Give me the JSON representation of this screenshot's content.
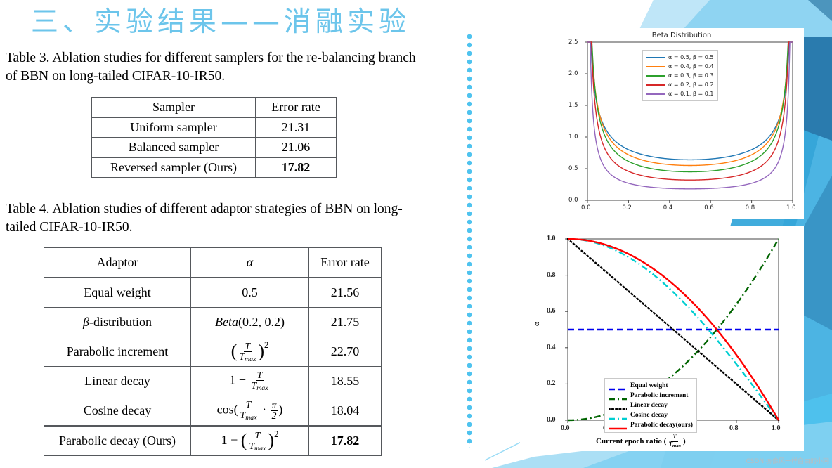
{
  "slide": {
    "title": "三、实验结果——消融实验",
    "title_color": "#6CC5EB",
    "background_accents": [
      "#8FD4F2",
      "#4FC3EF",
      "#2E86B8",
      "#2A7BAE",
      "#1F6B9A"
    ],
    "watermark": "CSDN @像风一样自由的小网"
  },
  "table3": {
    "caption": "Table 3. Ablation studies for different samplers for the re-balancing branch of BBN on long-tailed CIFAR-10-IR50.",
    "headers": [
      "Sampler",
      "Error rate"
    ],
    "rows": [
      {
        "sampler": "Uniform sampler",
        "error_rate": "21.31",
        "bold": false
      },
      {
        "sampler": "Balanced sampler",
        "error_rate": "21.06",
        "bold": false
      },
      {
        "sampler": "Reversed sampler (Ours)",
        "error_rate": "17.82",
        "bold": true
      }
    ]
  },
  "table4": {
    "caption": "Table 4. Ablation studies of different adaptor strategies of BBN on long-tailed CIFAR-10-IR50.",
    "headers": [
      "Adaptor",
      "α",
      "Error rate"
    ],
    "rows": [
      {
        "adaptor": "Equal weight",
        "alpha_text": "0.5",
        "error_rate": "21.56"
      },
      {
        "adaptor": "β-distribution",
        "alpha_text": "Beta(0.2, 0.2)",
        "error_rate": "21.75"
      },
      {
        "adaptor": "Parabolic increment",
        "alpha_text": "(T / Tmax)^2",
        "error_rate": "22.70"
      },
      {
        "adaptor": "Linear decay",
        "alpha_text": "1 − T / Tmax",
        "error_rate": "18.55"
      },
      {
        "adaptor": "Cosine decay",
        "alpha_text": "cos(T / Tmax · π/2)",
        "error_rate": "18.04"
      },
      {
        "adaptor": "Parabolic decay (Ours)",
        "alpha_text": "1 − (T / Tmax)^2",
        "error_rate": "17.82"
      }
    ]
  },
  "chart_data": [
    {
      "id": "beta-distribution",
      "type": "line",
      "title": "Beta Distribution",
      "xlabel": "",
      "ylabel": "",
      "xlim": [
        0.0,
        1.0
      ],
      "ylim": [
        0.0,
        2.5
      ],
      "xticks": [
        "0.0",
        "0.2",
        "0.4",
        "0.6",
        "0.8",
        "1.0"
      ],
      "yticks": [
        "0.0",
        "0.5",
        "1.0",
        "1.5",
        "2.0",
        "2.5"
      ],
      "grid": false,
      "legend_position": "upper center",
      "series": [
        {
          "name": "α = 0.5,  β = 0.5",
          "color": "#1f77b4",
          "style": "solid",
          "min_value": 0.64,
          "a": 0.5
        },
        {
          "name": "α = 0.4,  β = 0.4",
          "color": "#ff7f0e",
          "style": "solid",
          "min_value": 0.55,
          "a": 0.4
        },
        {
          "name": "α = 0.3,  β = 0.3",
          "color": "#2ca02c",
          "style": "solid",
          "min_value": 0.45,
          "a": 0.3
        },
        {
          "name": "α = 0.2,  β = 0.2",
          "color": "#d62728",
          "style": "solid",
          "min_value": 0.32,
          "a": 0.2
        },
        {
          "name": "α = 0.1,  β = 0.1",
          "color": "#9467bd",
          "style": "solid",
          "min_value": 0.18,
          "a": 0.1
        }
      ]
    },
    {
      "id": "adaptor-strategies",
      "type": "line",
      "title": "",
      "xlabel": "Current epoch ratio (T/Tmax)",
      "ylabel": "α",
      "xlim": [
        0.0,
        1.0
      ],
      "ylim": [
        0.0,
        1.0
      ],
      "xticks": [
        "0.0",
        "0.2",
        "0.4",
        "0.6",
        "0.8",
        "1.0"
      ],
      "yticks": [
        "0.0",
        "0.2",
        "0.4",
        "0.6",
        "0.8",
        "1.0"
      ],
      "grid": false,
      "legend_position": "lower left",
      "series": [
        {
          "name": "Equal weight",
          "color": "#0000ee",
          "style": "dashed",
          "formula": "0.5"
        },
        {
          "name": "Parabolic increment",
          "color": "#006400",
          "style": "dashdot",
          "formula": "t^2"
        },
        {
          "name": "Linear decay",
          "color": "#000000",
          "style": "dotted",
          "formula": "1-t"
        },
        {
          "name": "Cosine decay",
          "color": "#00CED1",
          "style": "dashdot",
          "formula": "cos(t*pi/2)"
        },
        {
          "name": "Parabolic decay(ours)",
          "color": "#ff0000",
          "style": "solid",
          "formula": "1-t^2"
        }
      ]
    }
  ]
}
